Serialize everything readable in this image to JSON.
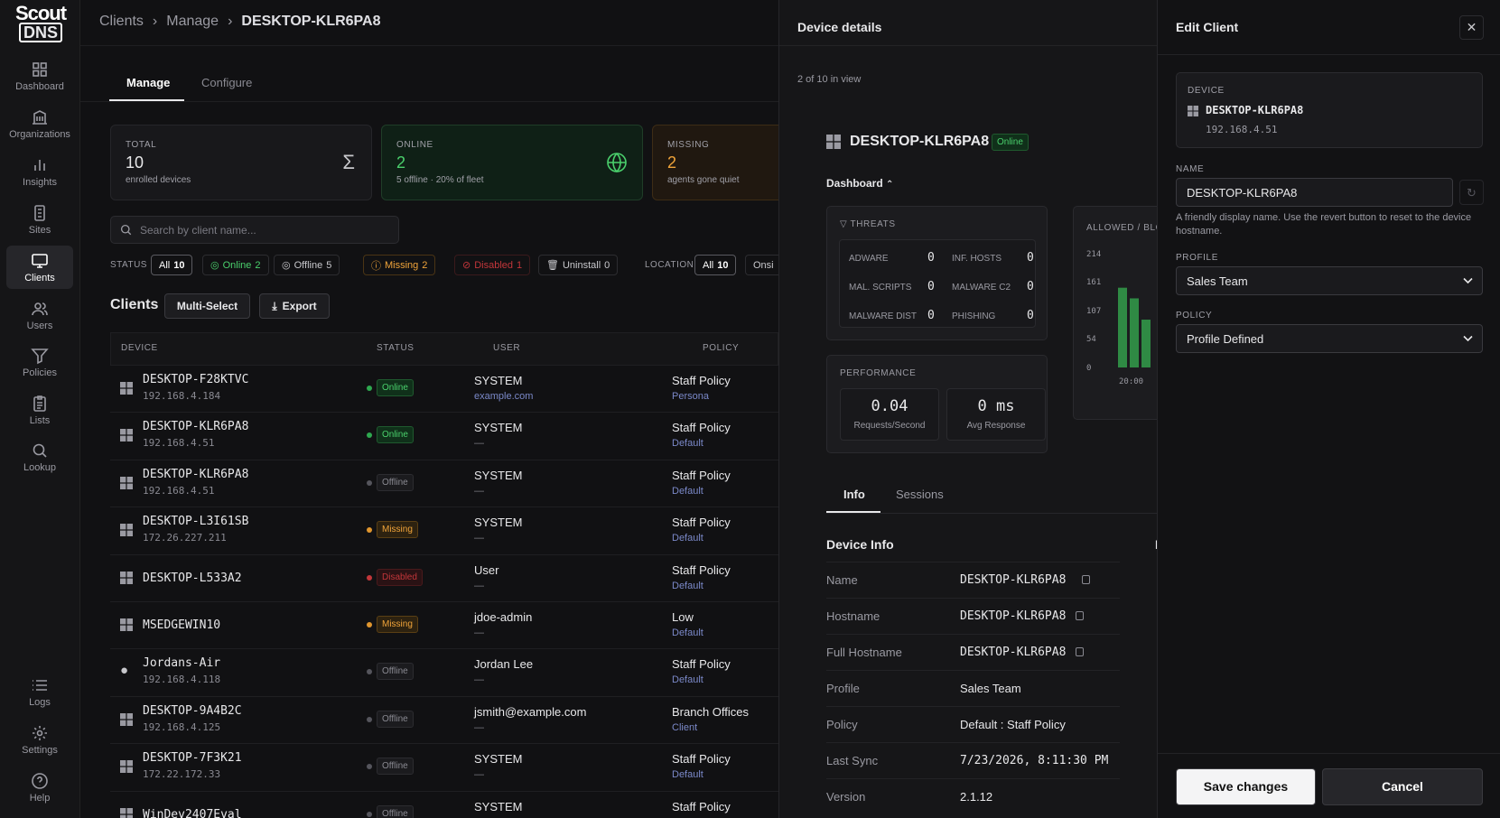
{
  "app": {
    "logo_line1": "Scout",
    "logo_line2": "DNS"
  },
  "sidebar": {
    "items": [
      {
        "label": "Dashboard"
      },
      {
        "label": "Organizations"
      },
      {
        "label": "Insights"
      },
      {
        "label": "Sites"
      },
      {
        "label": "Clients"
      },
      {
        "label": "Users"
      },
      {
        "label": "Policies"
      },
      {
        "label": "Lists"
      },
      {
        "label": "Lookup"
      }
    ],
    "bottom": [
      {
        "label": "Logs"
      },
      {
        "label": "Settings"
      },
      {
        "label": "Help"
      }
    ],
    "active": "Clients"
  },
  "breadcrumb": {
    "c1": "Clients",
    "c2": "Manage",
    "c3": "DESKTOP-KLR6PA8"
  },
  "tabs": {
    "manage": "Manage",
    "configure": "Configure"
  },
  "stats": {
    "total": {
      "label": "TOTAL",
      "value": "10",
      "sub": "enrolled devices",
      "icon": "sigma-icon"
    },
    "online": {
      "label": "ONLINE",
      "value": "2",
      "sub": "5 offline · 20% of fleet",
      "icon": "globe-icon"
    },
    "missing": {
      "label": "MISSING",
      "value": "2",
      "sub": "agents gone quiet"
    }
  },
  "search": {
    "placeholder": "Search by client name..."
  },
  "filters": {
    "status_label": "STATUS",
    "all": "All",
    "all_count": "10",
    "online": "Online",
    "online_count": "2",
    "offline": "Offline",
    "offline_count": "5",
    "missing": "Missing",
    "missing_count": "2",
    "disabled": "Disabled",
    "disabled_count": "1",
    "uninstall": "Uninstall",
    "uninstall_count": "0",
    "location_label": "LOCATION",
    "loc_all": "All",
    "loc_all_count": "10",
    "loc_onsite": "Onsi"
  },
  "clients": {
    "title": "Clients",
    "multiselect": "Multi-Select",
    "export": "Export",
    "columns": [
      "DEVICE",
      "STATUS",
      "USER",
      "POLICY"
    ],
    "rows": [
      {
        "os": "windows",
        "name": "DESKTOP-F28KTVC",
        "ip": "192.168.4.184",
        "status": "Online",
        "user": "SYSTEM",
        "user2": "example.com",
        "policy": "Staff Policy",
        "policy2": "Persona"
      },
      {
        "os": "windows",
        "name": "DESKTOP-KLR6PA8",
        "ip": "192.168.4.51",
        "status": "Online",
        "user": "SYSTEM",
        "user2": "—",
        "policy": "Staff Policy",
        "policy2": "Default"
      },
      {
        "os": "windows",
        "name": "DESKTOP-KLR6PA8",
        "ip": "192.168.4.51",
        "status": "Offline",
        "user": "SYSTEM",
        "user2": "—",
        "policy": "Staff Policy",
        "policy2": "Default"
      },
      {
        "os": "windows",
        "name": "DESKTOP-L3I61SB",
        "ip": "172.26.227.211",
        "status": "Missing",
        "user": "SYSTEM",
        "user2": "—",
        "policy": "Staff Policy",
        "policy2": "Default"
      },
      {
        "os": "windows",
        "name": "DESKTOP-L533A2",
        "ip": "",
        "status": "Disabled",
        "user": "User",
        "user2": "—",
        "policy": "Staff Policy",
        "policy2": "Default"
      },
      {
        "os": "windows",
        "name": "MSEDGEWIN10",
        "ip": "",
        "status": "Missing",
        "user": "jdoe-admin",
        "user2": "—",
        "policy": "Low",
        "policy2": "Default"
      },
      {
        "os": "apple",
        "name": "Jordans-Air",
        "ip": "192.168.4.118",
        "status": "Offline",
        "user": "Jordan Lee",
        "user2": "—",
        "policy": "Staff Policy",
        "policy2": "Default"
      },
      {
        "os": "windows",
        "name": "DESKTOP-9A4B2C",
        "ip": "192.168.4.125",
        "status": "Offline",
        "user": "jsmith@example.com",
        "user2": "—",
        "policy": "Branch Offices",
        "policy2": "Client"
      },
      {
        "os": "windows",
        "name": "DESKTOP-7F3K21",
        "ip": "172.22.172.33",
        "status": "Offline",
        "user": "SYSTEM",
        "user2": "—",
        "policy": "Staff Policy",
        "policy2": "Default"
      },
      {
        "os": "windows",
        "name": "WinDev2407Eval",
        "ip": "",
        "status": "Offline",
        "user": "SYSTEM",
        "user2": "",
        "policy": "Staff Policy",
        "policy2": ""
      }
    ]
  },
  "details": {
    "title": "Device details",
    "count": "2 of 10 in view",
    "device_name": "DESKTOP-KLR6PA8",
    "status": "Online",
    "dashboard_label": "Dashboard",
    "threats": {
      "title": "THREATS",
      "items": [
        {
          "label": "ADWARE",
          "value": "0"
        },
        {
          "label": "INF. HOSTS",
          "value": "0"
        },
        {
          "label": "MAL. SCRIPTS",
          "value": "0"
        },
        {
          "label": "MALWARE C2",
          "value": "0"
        },
        {
          "label": "MALWARE DIST",
          "value": "0"
        },
        {
          "label": "PHISHING",
          "value": "0"
        }
      ]
    },
    "performance": {
      "title": "PERFORMANCE",
      "rps_value": "0.04",
      "rps_label": "Requests/Second",
      "avg_value": "0 ms",
      "avg_label": "Avg Response"
    },
    "allowed": {
      "title": "ALLOWED / BLO",
      "ticks": [
        "214",
        "161",
        "107",
        "54",
        "0"
      ],
      "xtick": "20:00"
    },
    "tabs": {
      "info": "Info",
      "sessions": "Sessions"
    },
    "device_info_title": "Device Info",
    "info": [
      {
        "k": "Name",
        "v": "DESKTOP-KLR6PA8"
      },
      {
        "k": "Hostname",
        "v": "DESKTOP-KLR6PA8"
      },
      {
        "k": "Full Hostname",
        "v": "DESKTOP-KLR6PA8"
      },
      {
        "k": "Profile",
        "v": "Sales Team"
      },
      {
        "k": "Policy",
        "v": "Default : Staff Policy"
      },
      {
        "k": "Last Sync",
        "v": "7/23/2026, 8:11:30 PM"
      },
      {
        "k": "Version",
        "v": "2.1.12"
      }
    ],
    "right_col_clip": "N"
  },
  "chart_data": {
    "type": "bar",
    "title": "ALLOWED / BLO",
    "yticks": [
      0,
      54,
      107,
      161,
      214
    ],
    "ylim": [
      0,
      214
    ],
    "xticks": [
      "20:00"
    ],
    "values": [
      150,
      130,
      90
    ]
  },
  "edit": {
    "title": "Edit Client",
    "device_label": "DEVICE",
    "device_name": "DESKTOP-KLR6PA8",
    "device_ip": "192.168.4.51",
    "name_label": "NAME",
    "name_value": "DESKTOP-KLR6PA8",
    "name_help": "A friendly display name. Use the revert button to reset to the device hostname.",
    "profile_label": "PROFILE",
    "profile_value": "Sales Team",
    "policy_label": "POLICY",
    "policy_value": "Profile Defined",
    "save": "Save changes",
    "cancel": "Cancel"
  }
}
